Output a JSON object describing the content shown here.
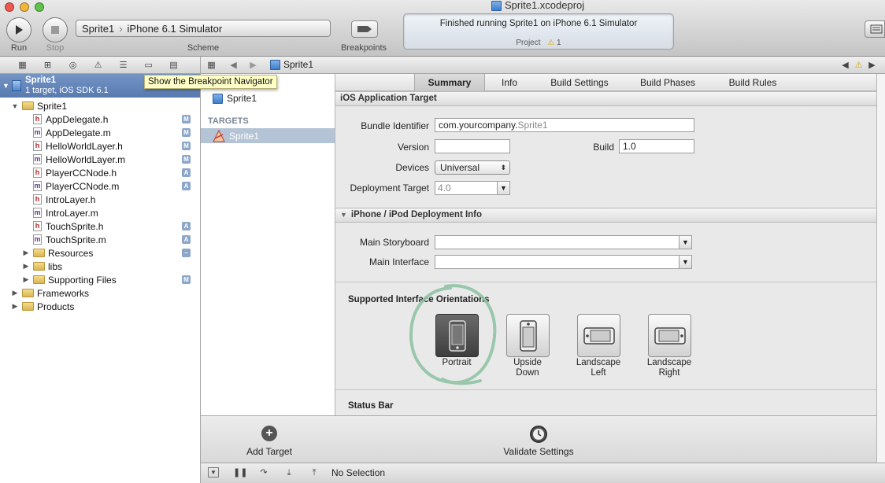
{
  "window": {
    "title": "Sprite1.xcodeproj",
    "traffic_colors": [
      "#ee5a4f",
      "#f3b63d",
      "#5ec44a"
    ]
  },
  "toolbar": {
    "run_label": "Run",
    "stop_label": "Stop",
    "scheme_label": "Scheme",
    "scheme_project": "Sprite1",
    "scheme_separator": "›",
    "scheme_destination": "iPhone 6.1 Simulator",
    "breakpoints_label": "Breakpoints",
    "activity_status": "Finished running Sprite1 on iPhone 6.1 Simulator",
    "activity_project": "Project",
    "activity_warnings": "1"
  },
  "tooltip": "Show the Breakpoint Navigator",
  "navigator": {
    "project_name": "Sprite1",
    "project_sub": "1 target, iOS SDK 6.1",
    "items": [
      {
        "name": "Sprite1",
        "kind": "folder",
        "level": 1,
        "disclosure": "▼",
        "badge": ""
      },
      {
        "name": "AppDelegate.h",
        "kind": "h",
        "level": 2,
        "disclosure": "",
        "badge": "M"
      },
      {
        "name": "AppDelegate.m",
        "kind": "m",
        "level": 2,
        "disclosure": "",
        "badge": "M"
      },
      {
        "name": "HelloWorldLayer.h",
        "kind": "h",
        "level": 2,
        "disclosure": "",
        "badge": "M"
      },
      {
        "name": "HelloWorldLayer.m",
        "kind": "m",
        "level": 2,
        "disclosure": "",
        "badge": "M"
      },
      {
        "name": "PlayerCCNode.h",
        "kind": "h",
        "level": 2,
        "disclosure": "",
        "badge": "A"
      },
      {
        "name": "PlayerCCNode.m",
        "kind": "m",
        "level": 2,
        "disclosure": "",
        "badge": "A"
      },
      {
        "name": "IntroLayer.h",
        "kind": "h",
        "level": 2,
        "disclosure": "",
        "badge": ""
      },
      {
        "name": "IntroLayer.m",
        "kind": "m",
        "level": 2,
        "disclosure": "",
        "badge": ""
      },
      {
        "name": "TouchSprite.h",
        "kind": "h",
        "level": 2,
        "disclosure": "",
        "badge": "A"
      },
      {
        "name": "TouchSprite.m",
        "kind": "m",
        "level": 2,
        "disclosure": "",
        "badge": "A"
      },
      {
        "name": "Resources",
        "kind": "folder",
        "level": 2,
        "disclosure": "▶",
        "badge": "–"
      },
      {
        "name": "libs",
        "kind": "folder",
        "level": 2,
        "disclosure": "▶",
        "badge": ""
      },
      {
        "name": "Supporting Files",
        "kind": "folder",
        "level": 2,
        "disclosure": "▶",
        "badge": "M"
      },
      {
        "name": "Frameworks",
        "kind": "folder",
        "level": 1,
        "disclosure": "▶",
        "badge": ""
      },
      {
        "name": "Products",
        "kind": "folder",
        "level": 1,
        "disclosure": "▶",
        "badge": ""
      }
    ]
  },
  "jumpbar": {
    "crumb": "Sprite1"
  },
  "targets_pane": {
    "project_item": "Sprite1",
    "targets_header": "TARGETS",
    "target_item": "Sprite1"
  },
  "editor": {
    "tabs": [
      "Summary",
      "Info",
      "Build Settings",
      "Build Phases",
      "Build Rules"
    ],
    "section_ios": "iOS Application Target",
    "bundle_identifier_label": "Bundle Identifier",
    "bundle_identifier_prefix": "com.yourcompany.",
    "bundle_identifier_suffix": "Sprite1",
    "version_label": "Version",
    "version_value": "",
    "build_label": "Build",
    "build_value": "1.0",
    "devices_label": "Devices",
    "devices_value": "Universal",
    "deployment_label": "Deployment Target",
    "deployment_value": "4.0",
    "section_iphone": "iPhone / iPod Deployment Info",
    "storyboard_label": "Main Storyboard",
    "interface_label": "Main Interface",
    "orientations_label": "Supported Interface Orientations",
    "orientations": [
      {
        "line1": "Portrait",
        "line2": ""
      },
      {
        "line1": "Upside",
        "line2": "Down"
      },
      {
        "line1": "Landscape",
        "line2": "Left"
      },
      {
        "line1": "Landscape",
        "line2": "Right"
      }
    ],
    "status_bar_label": "Status Bar"
  },
  "bottom": {
    "add_target_label": "Add Target",
    "validate_label": "Validate Settings",
    "debug_status": "No Selection"
  }
}
